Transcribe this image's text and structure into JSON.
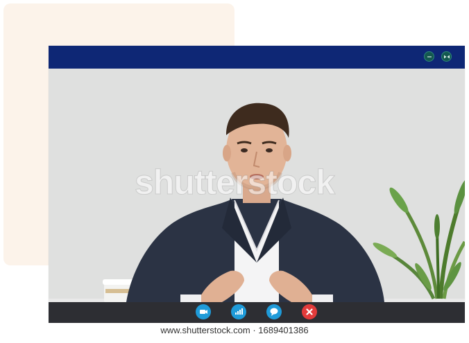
{
  "watermark": "shutterstock",
  "footer": {
    "image_id": "www.shutterstock.com · 1689401386"
  },
  "titlebar": {
    "color": "#0e2775",
    "buttons": [
      "minimize-icon",
      "maximize-icon"
    ]
  },
  "call_controls": {
    "bar_color": "#2d2e33",
    "buttons": [
      {
        "icon": "video-camera-icon",
        "color": "#1f9bd9"
      },
      {
        "icon": "signal-bars-icon",
        "color": "#1f9bd9"
      },
      {
        "icon": "chat-bubble-icon",
        "color": "#1f9bd9"
      },
      {
        "icon": "end-call-icon",
        "color": "#e23b3b"
      }
    ]
  },
  "colors": {
    "background_card": "#fcf3ea",
    "video_wall": "#dcdedd"
  }
}
